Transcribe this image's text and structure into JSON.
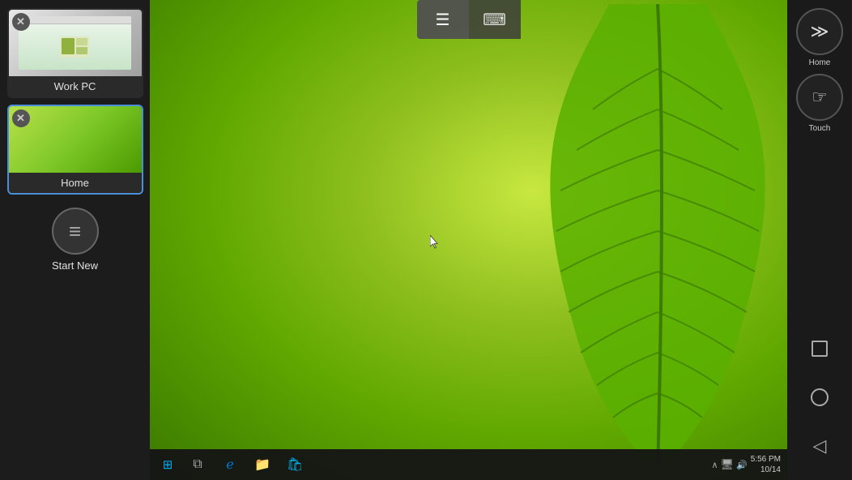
{
  "sidebar": {
    "sessions": [
      {
        "id": "work-pc",
        "label": "Work PC",
        "active": false,
        "type": "browser"
      },
      {
        "id": "home",
        "label": "Home",
        "active": true,
        "type": "desktop"
      }
    ],
    "start_new_label": "Start New"
  },
  "toolbar": {
    "menu_icon": "☰",
    "keyboard_icon": "⌨"
  },
  "right_controls": {
    "home_label": "Home",
    "touch_label": "Touch"
  },
  "taskbar": {
    "time": "5:56 PM",
    "date": "10/14"
  },
  "cursor": {
    "visible": true
  }
}
